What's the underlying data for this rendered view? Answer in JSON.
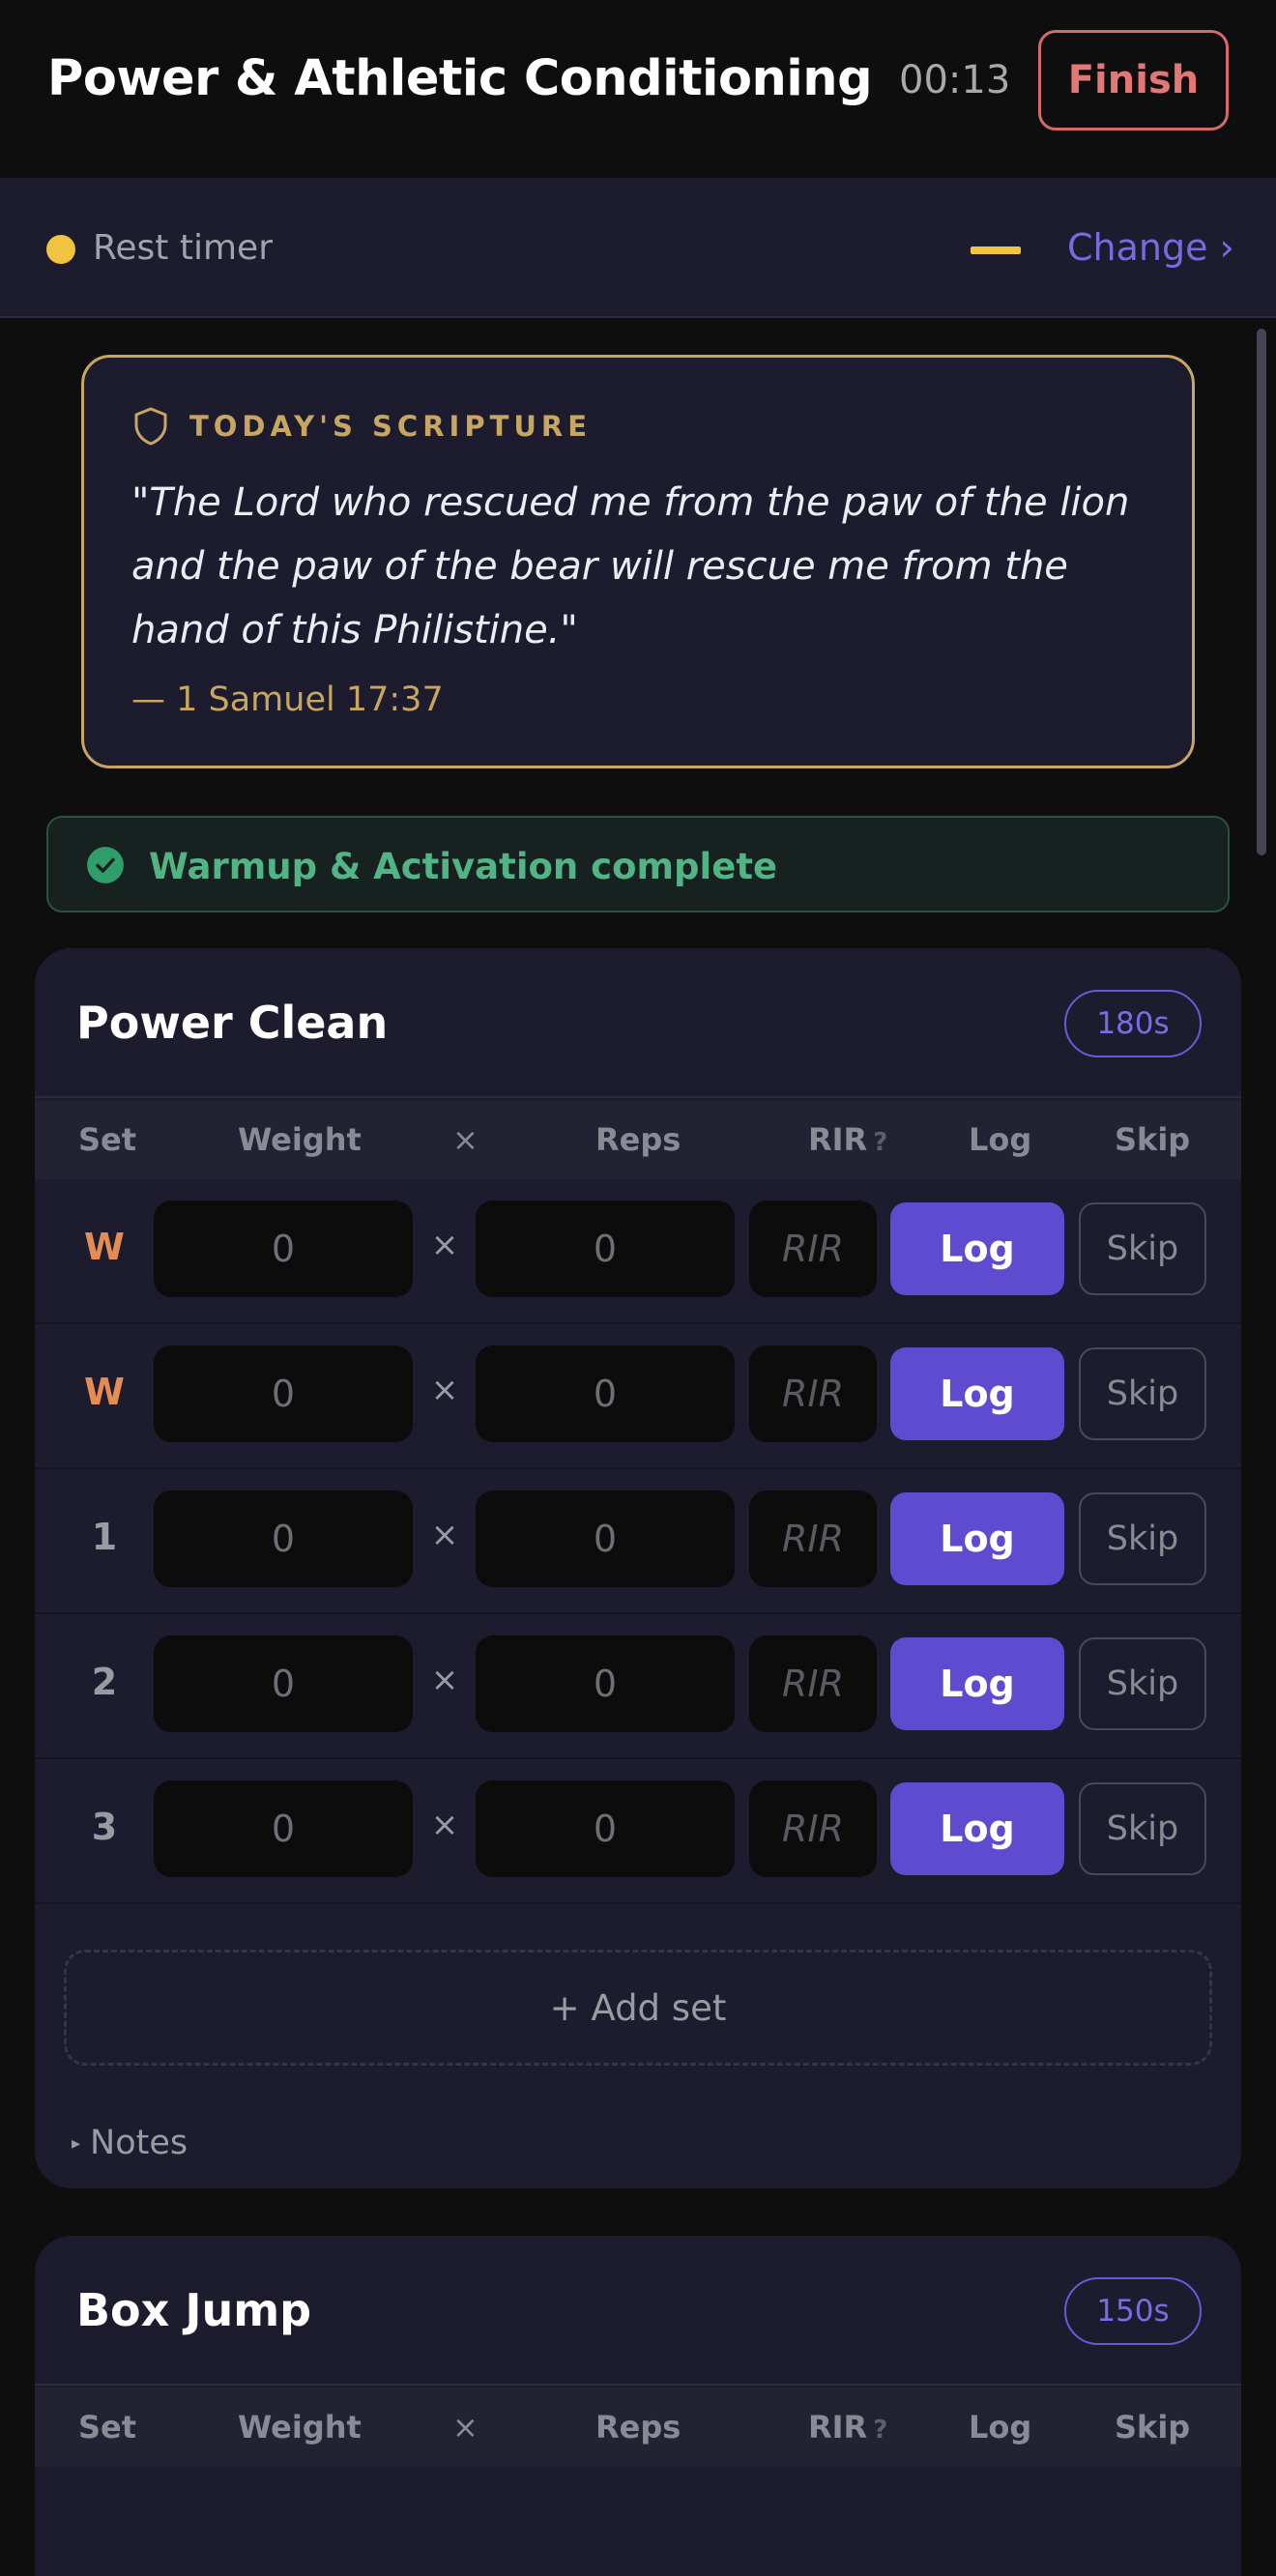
{
  "header": {
    "title": "Power & Athletic Conditioning",
    "elapsed": "00:13",
    "finish_label": "Finish"
  },
  "rest_timer": {
    "label": "Rest timer",
    "change_label": "Change ›"
  },
  "scripture": {
    "heading": "TODAY'S SCRIPTURE",
    "quote": "\"The Lord who rescued me from the paw of the lion and the paw of the bear will rescue me from the hand of this Philistine.\"",
    "reference": "— 1 Samuel 17:37"
  },
  "warmup": {
    "label": "Warmup & Activation complete"
  },
  "columns": {
    "set": "Set",
    "weight": "Weight",
    "times": "×",
    "reps": "Reps",
    "rir": "RIR",
    "rir_help": "?",
    "log": "Log",
    "skip": "Skip"
  },
  "exercises": [
    {
      "name": "Power Clean",
      "rest": "180s",
      "sets": [
        {
          "label": "W",
          "weight_placeholder": "0",
          "reps_placeholder": "0",
          "rir_placeholder": "RIR",
          "log_label": "Log",
          "skip_label": "Skip"
        },
        {
          "label": "W",
          "weight_placeholder": "0",
          "reps_placeholder": "0",
          "rir_placeholder": "RIR",
          "log_label": "Log",
          "skip_label": "Skip"
        },
        {
          "label": "1",
          "weight_placeholder": "0",
          "reps_placeholder": "0",
          "rir_placeholder": "RIR",
          "log_label": "Log",
          "skip_label": "Skip"
        },
        {
          "label": "2",
          "weight_placeholder": "0",
          "reps_placeholder": "0",
          "rir_placeholder": "RIR",
          "log_label": "Log",
          "skip_label": "Skip"
        },
        {
          "label": "3",
          "weight_placeholder": "0",
          "reps_placeholder": "0",
          "rir_placeholder": "RIR",
          "log_label": "Log",
          "skip_label": "Skip"
        }
      ],
      "add_set_label": "+ Add set",
      "notes_label": "Notes"
    },
    {
      "name": "Box Jump",
      "rest": "150s"
    }
  ],
  "colors": {
    "accent": "#5e4bd0",
    "warmup_set": "#e58c54",
    "scripture_gold": "#c8a560",
    "success": "#52b385",
    "danger": "#e27777",
    "rest_dot": "#f0c440"
  },
  "icons": {
    "scripture": "shield-icon",
    "warmup": "check-circle-icon",
    "notes": "triangle-right-icon"
  }
}
